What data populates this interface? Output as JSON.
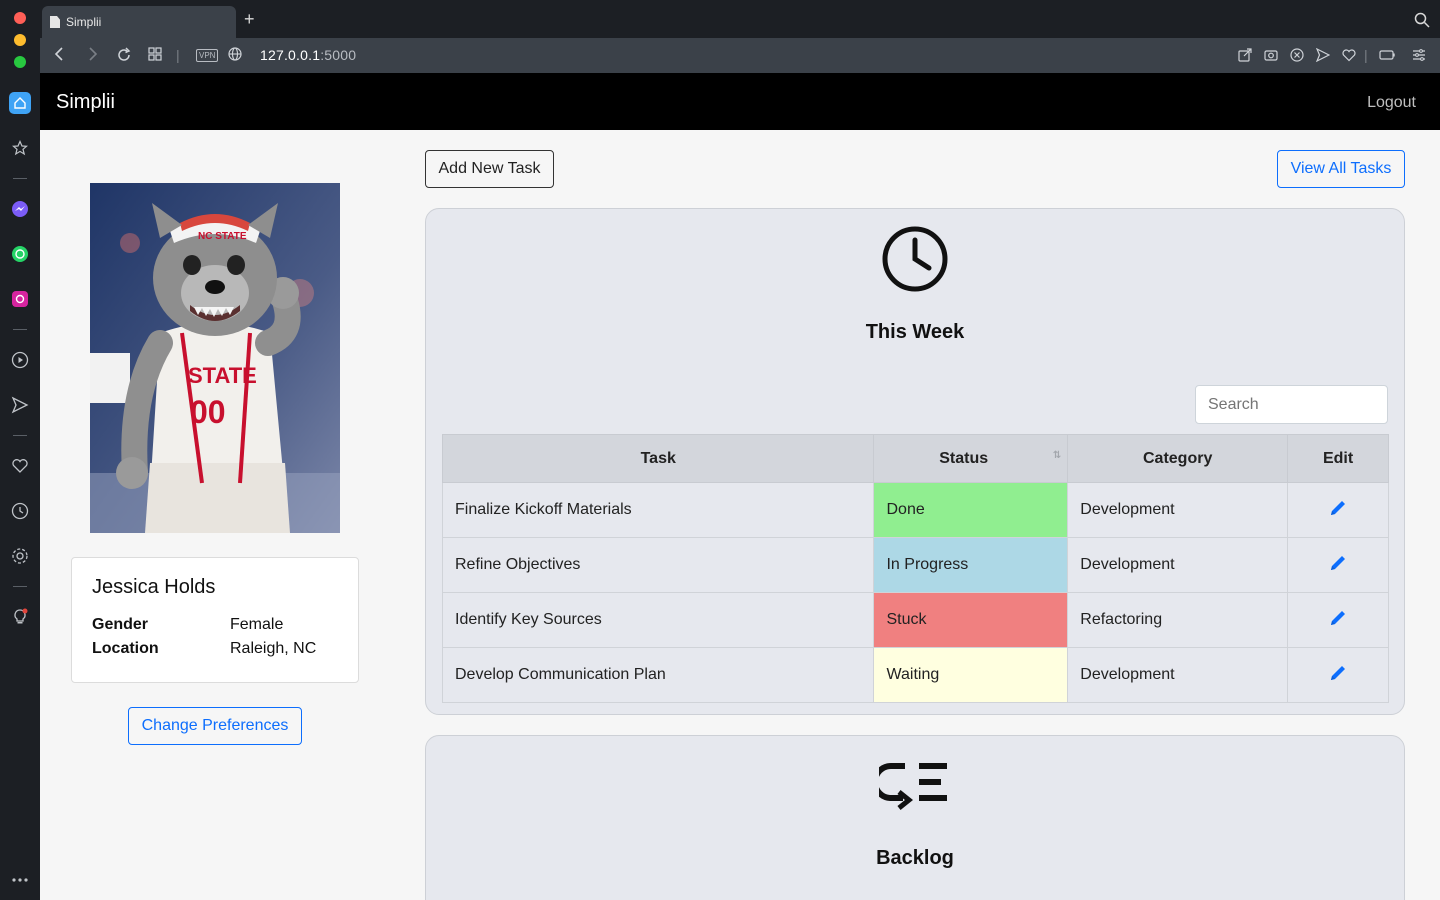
{
  "browser": {
    "tab_title": "Simplii",
    "url_host": "127.0.0.1",
    "url_port": ":5000",
    "vpn_label": "VPN"
  },
  "app": {
    "brand": "Simplii",
    "logout": "Logout"
  },
  "profile": {
    "name": "Jessica Holds",
    "fields": [
      {
        "label": "Gender",
        "value": "Female"
      },
      {
        "label": "Location",
        "value": "Raleigh, NC"
      }
    ],
    "change_prefs": "Change Preferences"
  },
  "actions": {
    "add_task": "Add New Task",
    "view_all": "View All Tasks"
  },
  "this_week": {
    "title": "This Week",
    "search_placeholder": "Search",
    "columns": [
      "Task",
      "Status",
      "Category",
      "Edit"
    ],
    "rows": [
      {
        "task": "Finalize Kickoff Materials",
        "status": "Done",
        "status_color": "#90ee90",
        "category": "Development"
      },
      {
        "task": "Refine Objectives",
        "status": "In Progress",
        "status_color": "#add8e6",
        "category": "Development"
      },
      {
        "task": "Identify Key Sources",
        "status": "Stuck",
        "status_color": "#f08080",
        "category": "Refactoring"
      },
      {
        "task": "Develop Communication Plan",
        "status": "Waiting",
        "status_color": "#ffffe0",
        "category": "Development"
      }
    ]
  },
  "backlog": {
    "title": "Backlog"
  },
  "colors": {
    "accent": "#0d6efd",
    "navbar": "#000000",
    "panel_bg": "#e6e8ee"
  }
}
